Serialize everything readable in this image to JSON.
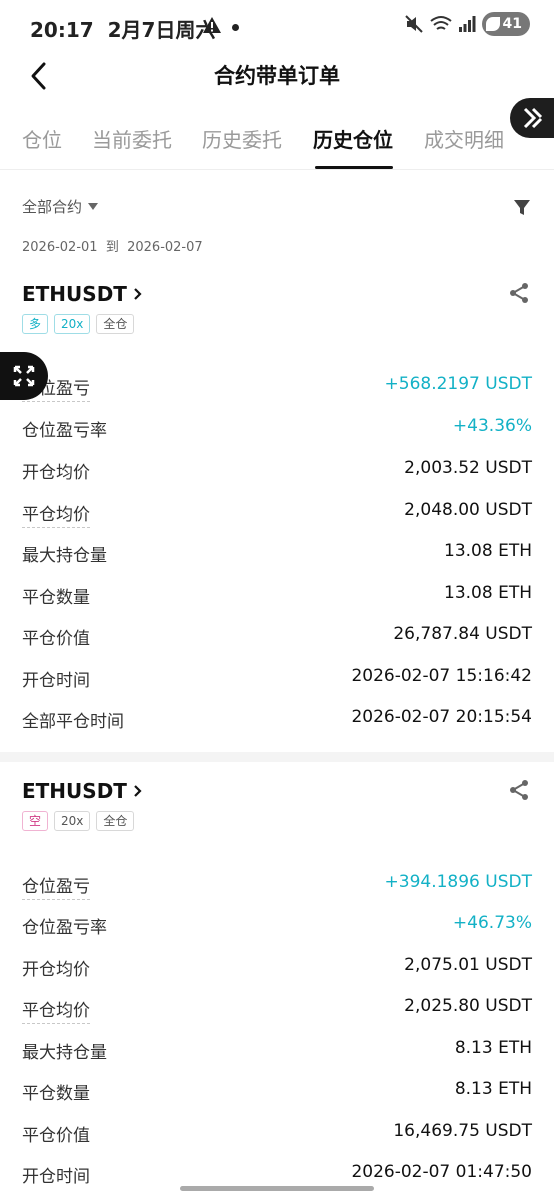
{
  "status": {
    "time": "20:17",
    "date": "2月7日周六",
    "battery": "41"
  },
  "nav": {
    "title": "合约带单订单"
  },
  "tabs": [
    "仓位",
    "当前委托",
    "历史委托",
    "历史仓位",
    "成交明细"
  ],
  "active_tab": "历史仓位",
  "filter": {
    "label": "全部合约"
  },
  "date_range": {
    "start": "2026-02-01",
    "sep": "到",
    "end": "2026-02-07"
  },
  "positions": [
    {
      "symbol": "ETHUSDT",
      "tags": [
        "多",
        "20x",
        "全仓"
      ],
      "rows": [
        {
          "label": "仓位盈亏",
          "value": "+568.2197 USDT"
        },
        {
          "label": "仓位盈亏率",
          "value": "+43.36%"
        },
        {
          "label": "开仓均价",
          "value": "2,003.52 USDT"
        },
        {
          "label": "平仓均价",
          "value": "2,048.00 USDT"
        },
        {
          "label": "最大持仓量",
          "value": "13.08 ETH"
        },
        {
          "label": "平仓数量",
          "value": "13.08 ETH"
        },
        {
          "label": "平仓价值",
          "value": "26,787.84 USDT"
        },
        {
          "label": "开仓时间",
          "value": "2026-02-07 15:16:42"
        },
        {
          "label": "全部平仓时间",
          "value": "2026-02-07 20:15:54"
        }
      ]
    },
    {
      "symbol": "ETHUSDT",
      "tags": [
        "空",
        "20x",
        "全仓"
      ],
      "rows": [
        {
          "label": "仓位盈亏",
          "value": "+394.1896 USDT"
        },
        {
          "label": "仓位盈亏率",
          "value": "+46.73%"
        },
        {
          "label": "开仓均价",
          "value": "2,075.01 USDT"
        },
        {
          "label": "平仓均价",
          "value": "2,025.80 USDT"
        },
        {
          "label": "最大持仓量",
          "value": "8.13 ETH"
        },
        {
          "label": "平仓数量",
          "value": "8.13 ETH"
        },
        {
          "label": "平仓价值",
          "value": "16,469.75 USDT"
        },
        {
          "label": "开仓时间",
          "value": "2026-02-07 01:47:50"
        }
      ]
    }
  ],
  "colors": {
    "positive": "#13b1c6",
    "short": "#d03a86"
  }
}
